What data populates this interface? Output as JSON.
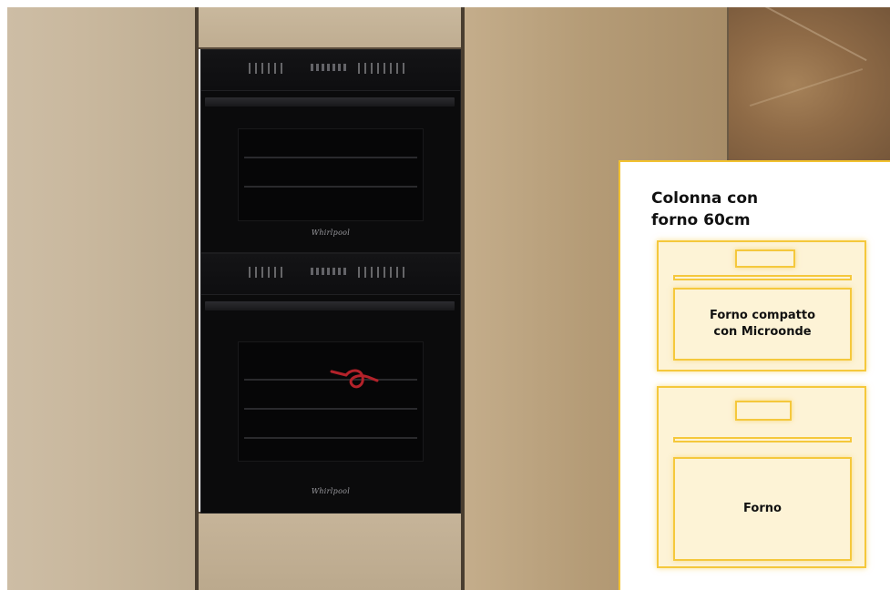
{
  "oven_brand": "Whirlpool",
  "info_card": {
    "title_line1": "Colonna con",
    "title_line2": "forno 60cm",
    "module_top_line1": "Forno compatto",
    "module_top_line2": "con Microonde",
    "module_bottom": "Forno"
  },
  "colors": {
    "accent_yellow": "#f5c83c",
    "module_fill": "#fdf3d6",
    "oven_black": "#0b0b0c",
    "cabinet_beige": "#c9b89e"
  }
}
